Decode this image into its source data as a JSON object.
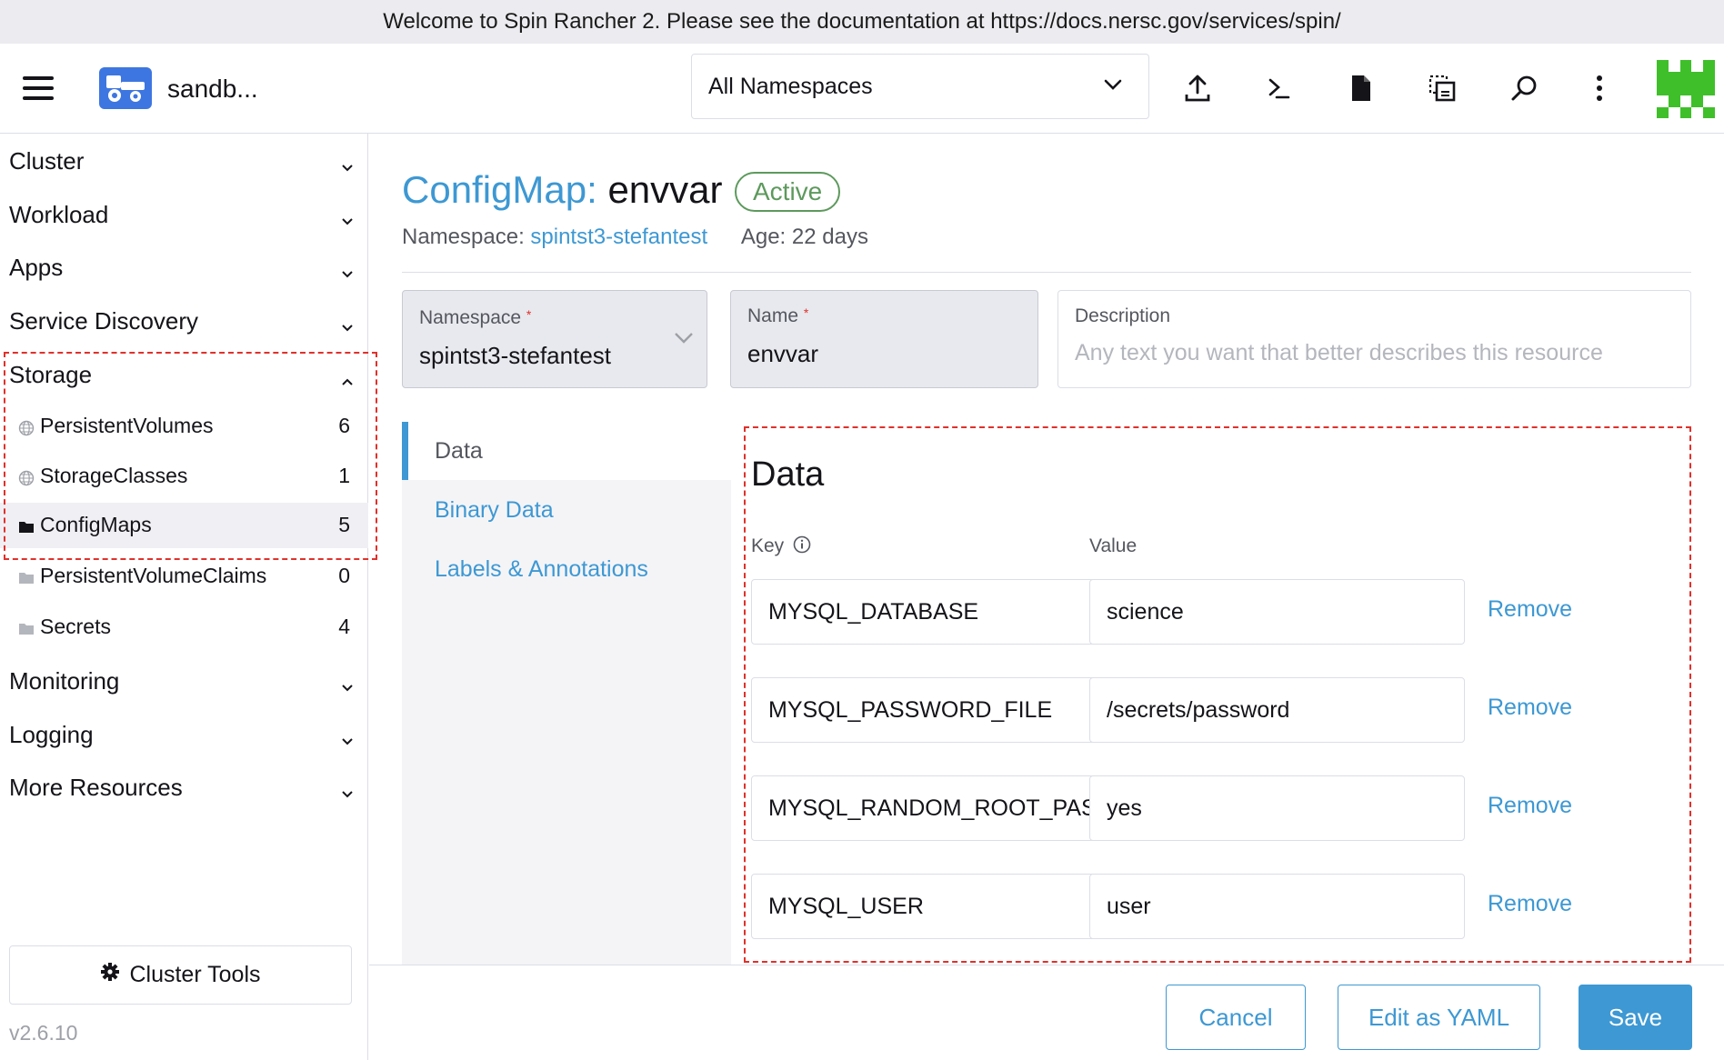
{
  "banner": {
    "text": "Welcome to Spin Rancher 2. Please see the documentation at https://docs.nersc.gov/services/spin/"
  },
  "header": {
    "cluster_name": "sandb...",
    "namespace_filter": "All Namespaces",
    "icons": [
      "import-yaml-icon",
      "kubectl-shell-icon",
      "kubeconfig-file-icon",
      "copy-kubeconfig-icon",
      "search-icon",
      "more-actions-icon"
    ]
  },
  "sidebar": {
    "groups_top": [
      {
        "label": "Cluster"
      },
      {
        "label": "Workload"
      },
      {
        "label": "Apps"
      },
      {
        "label": "Service Discovery"
      },
      {
        "label": "Storage"
      }
    ],
    "storage_items": [
      {
        "label": "PersistentVolumes",
        "count": "6",
        "icon": "globe-icon"
      },
      {
        "label": "StorageClasses",
        "count": "1",
        "icon": "globe-icon"
      },
      {
        "label": "ConfigMaps",
        "count": "5",
        "icon": "folder-icon"
      },
      {
        "label": "PersistentVolumeClaims",
        "count": "0",
        "icon": "folder-icon"
      },
      {
        "label": "Secrets",
        "count": "4",
        "icon": "folder-icon"
      }
    ],
    "groups_bottom": [
      {
        "label": "Monitoring"
      },
      {
        "label": "Logging"
      },
      {
        "label": "More Resources"
      }
    ],
    "cluster_tools": "Cluster Tools",
    "version": "v2.6.10"
  },
  "resource": {
    "kind": "ConfigMap:",
    "name": "envvar",
    "state": "Active",
    "namespace_label": "Namespace:",
    "namespace": "spintst3-stefantest",
    "age": "Age: 22 days"
  },
  "form": {
    "namespace": {
      "label": "Namespace",
      "value": "spintst3-stefantest"
    },
    "name": {
      "label": "Name",
      "value": "envvar"
    },
    "description": {
      "label": "Description",
      "placeholder": "Any text you want that better describes this resource"
    },
    "required_mark": "*"
  },
  "tabs": [
    {
      "label": "Data"
    },
    {
      "label": "Binary Data"
    },
    {
      "label": "Labels & Annotations"
    }
  ],
  "data": {
    "title": "Data",
    "key_label": "Key",
    "value_label": "Value",
    "remove_label": "Remove",
    "rows": [
      {
        "key": "MYSQL_DATABASE",
        "value": "science"
      },
      {
        "key": "MYSQL_PASSWORD_FILE",
        "value": "/secrets/password"
      },
      {
        "key": "MYSQL_RANDOM_ROOT_PASSWORD",
        "value": "yes"
      },
      {
        "key": "MYSQL_USER",
        "value": "user"
      }
    ]
  },
  "footer": {
    "cancel": "Cancel",
    "edit_yaml": "Edit as YAML",
    "save": "Save"
  },
  "colors": {
    "accent": "#3d98d3",
    "active_badge": "#5d995d",
    "highlight": "#e0312b",
    "logo": "#3d76e0"
  }
}
